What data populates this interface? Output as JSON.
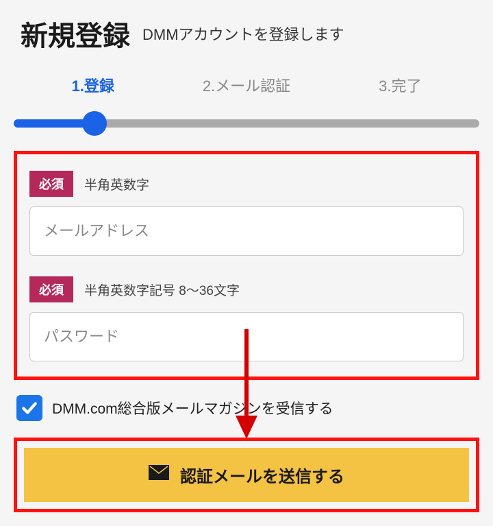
{
  "header": {
    "title": "新規登録",
    "subtitle": "DMMアカウントを登録します"
  },
  "steps": {
    "s1": "1.登録",
    "s2": "2.メール認証",
    "s3": "3.完了"
  },
  "form": {
    "required_label": "必須",
    "email_hint": "半角英数字",
    "email_placeholder": "メールアドレス",
    "password_hint": "半角英数字記号 8〜36文字",
    "password_placeholder": "パスワード"
  },
  "checkbox": {
    "label": "DMM.com総合版メールマガジンを受信する"
  },
  "submit": {
    "label": "認証メールを送信する"
  },
  "colors": {
    "accent_blue": "#1a62e6",
    "highlight_red": "#ff1111",
    "badge_magenta": "#b5295a",
    "button_yellow": "#f5c343"
  }
}
